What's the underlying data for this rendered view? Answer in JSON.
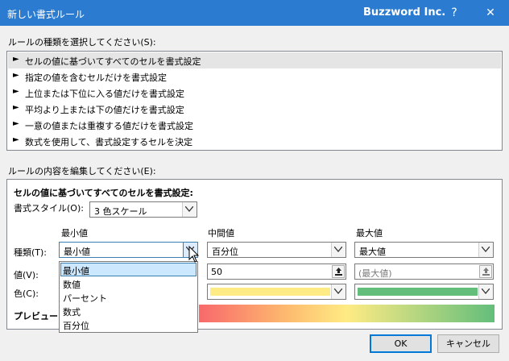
{
  "window": {
    "title": "新しい書式ルール",
    "brand": "Buzzword Inc.",
    "help_label": "?",
    "close_label": "✕"
  },
  "rule_type": {
    "label": "ルールの種類を選択してください(S):",
    "items": [
      "セルの値に基づいてすべてのセルを書式設定",
      "指定の値を含むセルだけを書式設定",
      "上位または下位に入る値だけを書式設定",
      "平均より上または下の値だけを書式設定",
      "一意の値または重複する値だけを書式設定",
      "数式を使用して、書式設定するセルを決定"
    ],
    "selected_index": 0,
    "bullet": "►"
  },
  "edit": {
    "label": "ルールの内容を編集してください(E):",
    "heading": "セルの値に基づいてすべてのセルを書式設定:",
    "format_style_label": "書式スタイル(O):",
    "format_style_value": "3 色スケール",
    "col_min": "最小値",
    "col_mid": "中間値",
    "col_max": "最大値",
    "type_label": "種類(T):",
    "value_label": "値(V):",
    "color_label": "色(C):",
    "preview_label": "プレビュー:",
    "min_type": "最小値",
    "mid_type": "百分位",
    "max_type": "最大値",
    "mid_value": "50",
    "max_value_placeholder": "(最大値)",
    "mid_color": "#ffeb84",
    "max_color": "#63be7b"
  },
  "dropdown": {
    "options": [
      "最小値",
      "数値",
      "パーセント",
      "数式",
      "百分位"
    ],
    "selected_index": 0
  },
  "buttons": {
    "ok": "OK",
    "cancel": "キャンセル"
  }
}
